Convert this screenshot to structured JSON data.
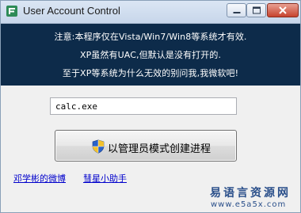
{
  "window": {
    "title": "User Account Control"
  },
  "notice": {
    "line1": "注意:本程序仅在Vista/Win7/Win8等系统才有效.",
    "line2": "XP虽然有UAC,但默认是没有打开的.",
    "line3": "至于XP等系统为什么无效的别问我,我微软吧!"
  },
  "command": {
    "value": "calc.exe"
  },
  "action": {
    "label": "以管理员模式创建进程",
    "icon": "uac-shield-icon"
  },
  "links": {
    "weibo": "邓学彬的微博",
    "helper": "彗星小助手"
  },
  "watermark": {
    "name": "易语言资源网",
    "url": "www.e5a5x.com"
  },
  "colors": {
    "notice_bg": "#0d2b4a",
    "link": "#0000cc",
    "close_button": "#c7432e"
  }
}
